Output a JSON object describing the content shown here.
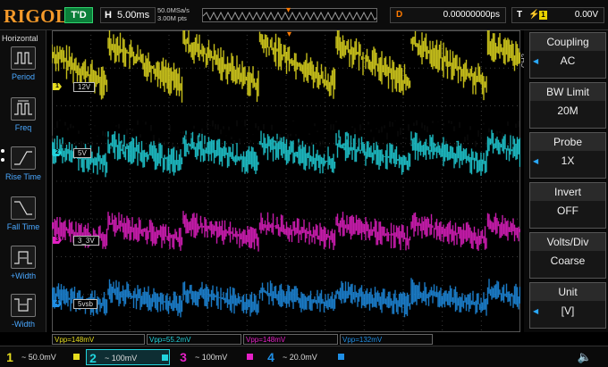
{
  "top": {
    "logo": "RIGOL",
    "trigger_status": "T'D",
    "horizontal_label": "H",
    "timebase": "5.00ms",
    "sample_rate": "50.0MSa/s",
    "memory_depth": "3.00M pts",
    "delay_label": "D",
    "delay_value": "0.00000000ps",
    "trigger_label": "T",
    "trigger_source": "1",
    "trigger_level": "0.00V"
  },
  "left_menu": {
    "title": "Horizontal",
    "items": [
      "Period",
      "Freq",
      "Rise Time",
      "Fall Time",
      "+Width",
      "-Width"
    ]
  },
  "channels": [
    {
      "tag": "12V",
      "marker": "1",
      "color": "#e6dd1f"
    },
    {
      "tag": "5V",
      "marker": "2",
      "color": "#21d4dd"
    },
    {
      "tag": "3_3V",
      "marker": "3",
      "color": "#e620c6"
    },
    {
      "tag": "5vsb",
      "marker": "4",
      "color": "#1f8fe6"
    }
  ],
  "right_menu": {
    "side_label": "CH2",
    "items": [
      {
        "label": "Coupling",
        "value": "AC"
      },
      {
        "label": "BW Limit",
        "value": "20M"
      },
      {
        "label": "Probe",
        "value": "1X"
      },
      {
        "label": "Invert",
        "value": "OFF"
      },
      {
        "label": "Volts/Div",
        "value": "Coarse"
      },
      {
        "label": "Unit",
        "value": "[V]"
      }
    ]
  },
  "measurements": [
    "Vpp=148mV",
    "Vpp=55.2mV",
    "Vpp=148mV",
    "Vpp=132mV"
  ],
  "bottom_channels": [
    {
      "num": "1",
      "scale": "50.0mV",
      "color": "#e6dd1f"
    },
    {
      "num": "2",
      "scale": "100mV",
      "color": "#21d4dd"
    },
    {
      "num": "3",
      "scale": "100mV",
      "color": "#e620c6"
    },
    {
      "num": "4",
      "scale": "20.0mV",
      "color": "#1f8fe6"
    }
  ]
}
